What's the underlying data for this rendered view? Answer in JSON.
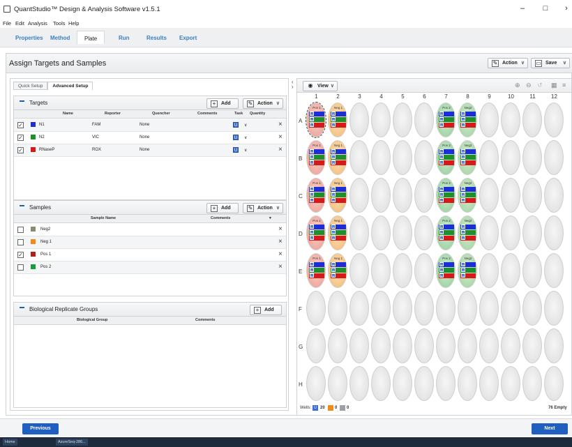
{
  "window": {
    "title": "QuantStudio™ Design & Analysis Software v1.5.1",
    "controls": [
      "–",
      "□",
      "›"
    ]
  },
  "menu": [
    "File",
    "Edit",
    "Analysis",
    "Tools",
    "Help"
  ],
  "tabs": [
    {
      "label": "Properties",
      "active": false
    },
    {
      "label": "Method",
      "active": false
    },
    {
      "label": "Plate",
      "active": true
    },
    {
      "label": "Run",
      "active": false
    },
    {
      "label": "Results",
      "active": false
    },
    {
      "label": "Export",
      "active": false
    }
  ],
  "header": {
    "title": "Assign Targets and Samples",
    "action_label": "Action",
    "save_label": "Save"
  },
  "subtabs": [
    {
      "label": "Quick Setup"
    },
    {
      "label": "Advanced Setup"
    }
  ],
  "targets": {
    "title": "Targets",
    "add_label": "Add",
    "action_label": "Action",
    "columns": [
      "Name",
      "Reporter",
      "Quencher",
      "Comments",
      "Task",
      "Quantity"
    ],
    "rows": [
      {
        "checked": "✓",
        "color": "#1a2fd6",
        "name": "N1",
        "reporter": "FAM",
        "quencher": "None",
        "task": "U"
      },
      {
        "checked": "✓",
        "color": "#1e8f2a",
        "name": "N2",
        "reporter": "VIC",
        "quencher": "None",
        "task": "U"
      },
      {
        "checked": "✓",
        "color": "#d61a1a",
        "name": "RNaseP",
        "reporter": "ROX",
        "quencher": "None",
        "task": "U"
      }
    ]
  },
  "samples": {
    "title": "Samples",
    "add_label": "Add",
    "action_label": "Action",
    "columns": [
      "Sample Name",
      "Comments"
    ],
    "rows": [
      {
        "checked": "",
        "color": "#8a8a70",
        "name": "Neg2"
      },
      {
        "checked": "",
        "color": "#f28a1a",
        "name": "Neg 1"
      },
      {
        "checked": "✓",
        "color": "#b0201a",
        "name": "Pos 1"
      },
      {
        "checked": "",
        "color": "#1a9a40",
        "name": "Pos 2"
      }
    ]
  },
  "bio": {
    "title": "Biological Replicate Groups",
    "add_label": "Add",
    "columns": [
      "Biological Group",
      "Comments"
    ]
  },
  "plate": {
    "view_label": "View",
    "col_labels": [
      "1",
      "2",
      "3",
      "4",
      "5",
      "6",
      "7",
      "8",
      "9",
      "10",
      "11",
      "12"
    ],
    "row_labels": [
      "A",
      "B",
      "C",
      "D",
      "E",
      "F",
      "G",
      "H"
    ],
    "well_labels": {
      "pos1": "Pos 1",
      "neg1": "Neg 1",
      "pos2": "Pos 2",
      "neg2": "Neg2"
    },
    "task_letter": "U",
    "wells_prefix": "Wells:",
    "wells_u": "20",
    "wells_s": "0",
    "wells_n": "0",
    "empty_label": "76 Empty"
  },
  "footer": {
    "previous": "Previous",
    "next": "Next"
  },
  "taskbar": {
    "home": "Home",
    "item": "AzureSeq-286..."
  },
  "colors": {
    "accent": "#1f5fbf",
    "fam": "#1a2fd6",
    "vic": "#1e8f2a",
    "rox": "#d61a1a"
  }
}
